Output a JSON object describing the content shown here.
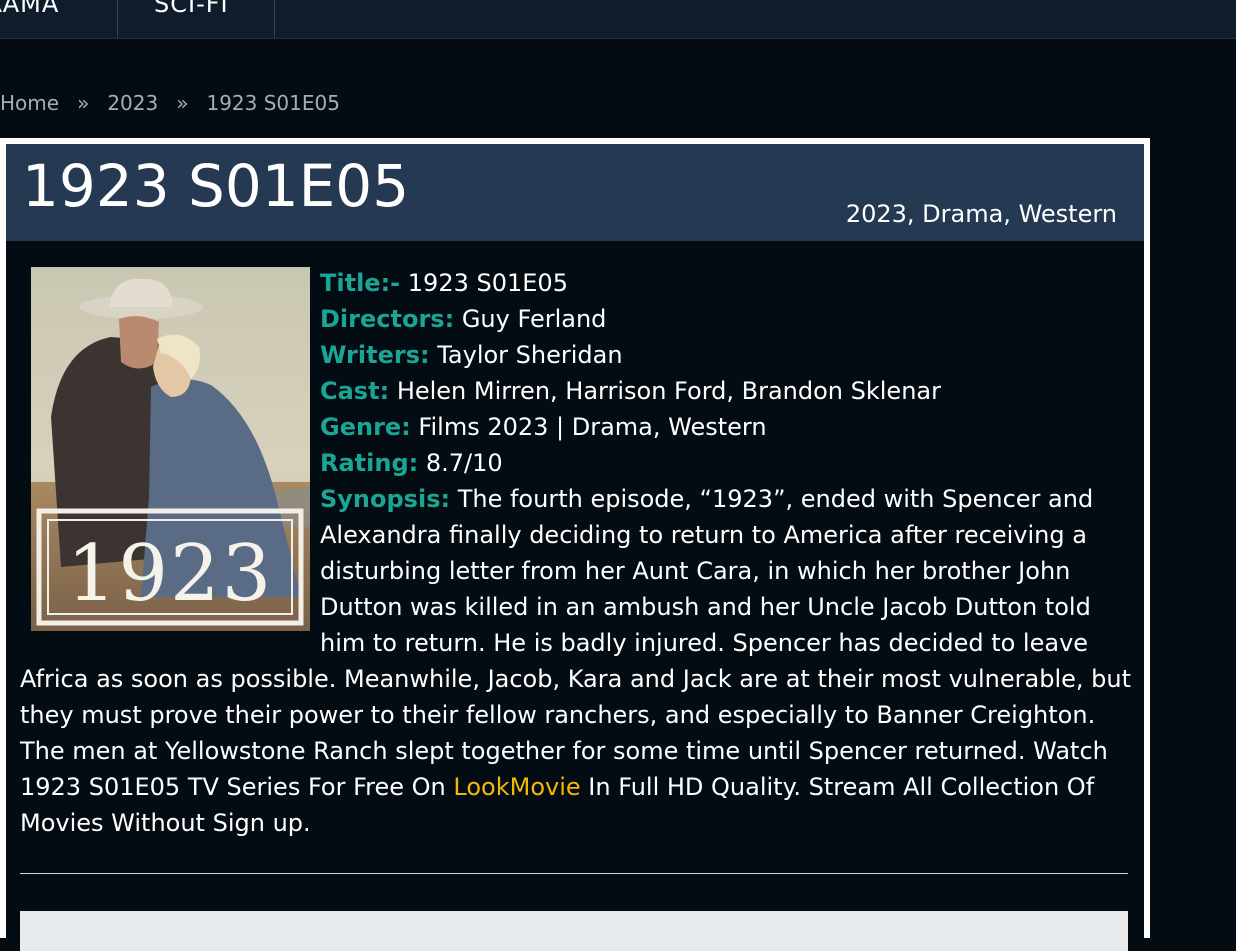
{
  "nav": {
    "items": [
      "RAMA",
      "SCI-FI"
    ]
  },
  "breadcrumb": {
    "home": "Home",
    "separator": "»",
    "year": "2023",
    "current": "1923 S01E05"
  },
  "header": {
    "title": "1923 S01E05",
    "meta": "2023, Drama, Western"
  },
  "poster": {
    "text": "1923"
  },
  "details": {
    "title_label": "Title:-",
    "title_value": "1923 S01E05",
    "directors_label": "Directors:",
    "directors_value": "Guy Ferland",
    "writers_label": "Writers:",
    "writers_value": "Taylor Sheridan",
    "cast_label": "Cast:",
    "cast_value": "Helen Mirren, Harrison Ford, Brandon Sklenar",
    "genre_label": "Genre:",
    "genre_value": "Films 2023 | Drama, Western",
    "rating_label": "Rating:",
    "rating_value": "8.7/10",
    "synopsis_label": "Synopsis:",
    "synopsis_text": "The fourth episode, “1923”, ended with Spencer and Alexandra finally deciding to return to America after receiving a disturbing letter from her Aunt Cara, in which her brother John Dutton was killed in an ambush and her Uncle Jacob Dutton told him to return. He is badly injured. Spencer has decided to leave Africa as soon as possible. Meanwhile, Jacob, Kara and Jack are at their most vulnerable, but they must prove their power to their fellow ranchers, and especially to Banner Creighton. The men at Yellowstone Ranch slept together for some time until Spencer returned. Watch 1923 S01E05 TV Series For Free On",
    "link_text": "LookMovie",
    "synopsis_tail": "In Full HD Quality. Stream All Collection Of Movies Without Sign up."
  },
  "colors": {
    "label": "#1aa594",
    "link": "#f2b705",
    "title_bar": "#253a52",
    "background": "#040b13"
  }
}
